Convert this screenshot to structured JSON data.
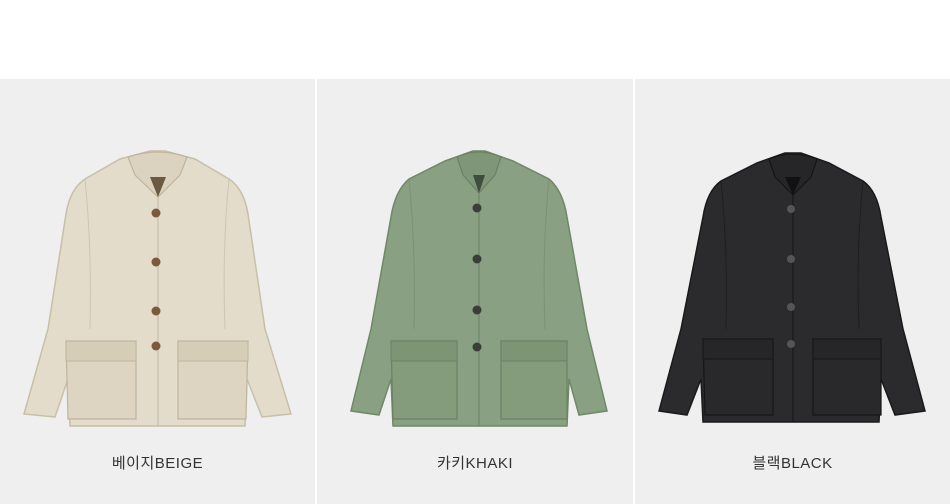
{
  "products": [
    {
      "label": "베이지BEIGE",
      "image": "beige-jacket",
      "color": "#e3dccb"
    },
    {
      "label": "카키KHAKI",
      "image": "khaki-jacket",
      "color": "#8aa082"
    },
    {
      "label": "블랙BLACK",
      "image": "black-jacket",
      "color": "#2b2b2d"
    }
  ]
}
